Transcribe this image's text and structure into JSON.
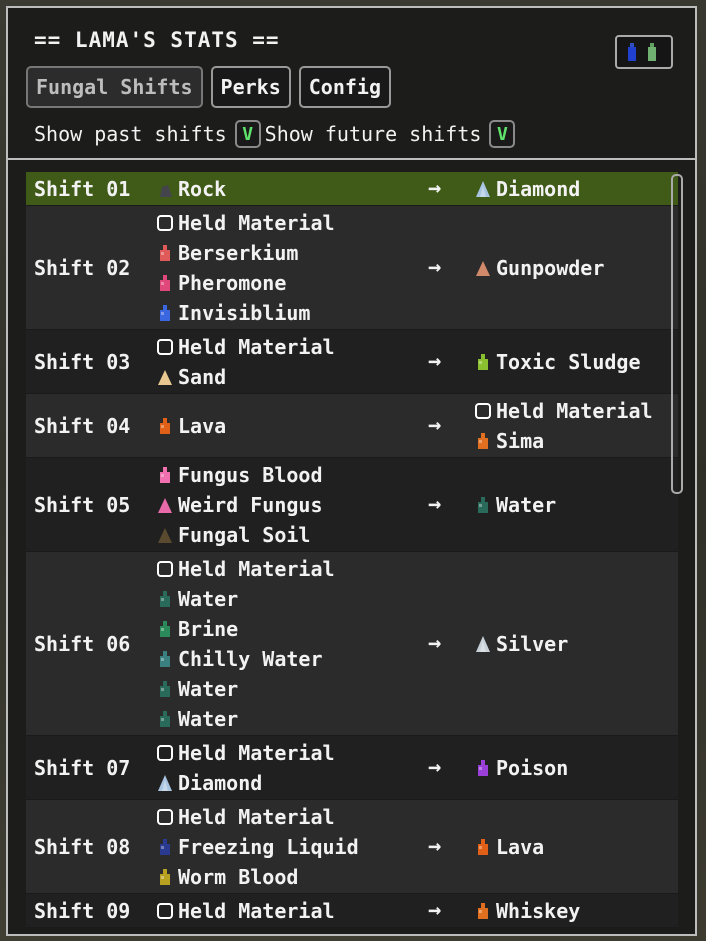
{
  "window": {
    "title": "== LAMA'S STATS ==",
    "close_icon": "potion-pair-icon",
    "tabs": [
      "Fungal Shifts",
      "Perks",
      "Config"
    ],
    "active_tab": "Fungal Shifts"
  },
  "options": {
    "show_past_label": "Show past shifts",
    "show_past_value": "V",
    "show_future_label": "Show future shifts",
    "show_future_value": "V"
  },
  "shifts": [
    {
      "label": "Shift 01",
      "highlight": true,
      "from": [
        {
          "name": "Rock",
          "icon": "rock-icon",
          "color": "#44444c"
        }
      ],
      "to": [
        {
          "name": "Diamond",
          "icon": "crystal-icon",
          "color": "#a8c4e0"
        }
      ]
    },
    {
      "label": "Shift 02",
      "from": [
        {
          "name": "Held Material",
          "icon": "held-material-icon",
          "color": "#ffffff"
        },
        {
          "name": "Berserkium",
          "icon": "flask-icon",
          "color": "#e05a5a"
        },
        {
          "name": "Pheromone",
          "icon": "flask-icon",
          "color": "#e0477a"
        },
        {
          "name": "Invisiblium",
          "icon": "flask-icon",
          "color": "#3a66e0"
        }
      ],
      "to": [
        {
          "name": "Gunpowder",
          "icon": "powder-icon",
          "color": "#d08a6a"
        }
      ]
    },
    {
      "label": "Shift 03",
      "from": [
        {
          "name": "Held Material",
          "icon": "held-material-icon",
          "color": "#ffffff"
        },
        {
          "name": "Sand",
          "icon": "powder-icon",
          "color": "#e8c890"
        }
      ],
      "to": [
        {
          "name": "Toxic Sludge",
          "icon": "flask-icon",
          "color": "#8ac030"
        }
      ]
    },
    {
      "label": "Shift 04",
      "from": [
        {
          "name": "Lava",
          "icon": "flask-icon",
          "color": "#e06018"
        }
      ],
      "to": [
        {
          "name": "Held Material",
          "icon": "held-material-icon",
          "color": "#ffffff"
        },
        {
          "name": "Sima",
          "icon": "flask-icon",
          "color": "#e07020"
        }
      ]
    },
    {
      "label": "Shift 05",
      "from": [
        {
          "name": "Fungus Blood",
          "icon": "flask-icon",
          "color": "#f070b0"
        },
        {
          "name": "Weird Fungus",
          "icon": "powder-icon",
          "color": "#e86aa8"
        },
        {
          "name": "Fungal Soil",
          "icon": "powder-icon",
          "color": "#5a4a30"
        }
      ],
      "to": [
        {
          "name": "Water",
          "icon": "flask-icon",
          "color": "#2a6a5a"
        }
      ]
    },
    {
      "label": "Shift 06",
      "from": [
        {
          "name": "Held Material",
          "icon": "held-material-icon",
          "color": "#ffffff"
        },
        {
          "name": "Water",
          "icon": "flask-icon",
          "color": "#2a6a5a"
        },
        {
          "name": "Brine",
          "icon": "flask-icon",
          "color": "#2a8a5a"
        },
        {
          "name": "Chilly Water",
          "icon": "flask-icon",
          "color": "#3a8080"
        },
        {
          "name": "Water",
          "icon": "flask-icon",
          "color": "#2a6a5a"
        },
        {
          "name": "Water",
          "icon": "flask-icon",
          "color": "#2a6a5a"
        }
      ],
      "to": [
        {
          "name": "Silver",
          "icon": "crystal-icon",
          "color": "#c8d0d8"
        }
      ]
    },
    {
      "label": "Shift 07",
      "from": [
        {
          "name": "Held Material",
          "icon": "held-material-icon",
          "color": "#ffffff"
        },
        {
          "name": "Diamond",
          "icon": "crystal-icon",
          "color": "#a8c4e0"
        }
      ],
      "to": [
        {
          "name": "Poison",
          "icon": "flask-icon",
          "color": "#9a40d8"
        }
      ]
    },
    {
      "label": "Shift 08",
      "from": [
        {
          "name": "Held Material",
          "icon": "held-material-icon",
          "color": "#ffffff"
        },
        {
          "name": "Freezing Liquid",
          "icon": "flask-icon",
          "color": "#2a3a90"
        },
        {
          "name": "Worm Blood",
          "icon": "flask-icon",
          "color": "#b8a020"
        }
      ],
      "to": [
        {
          "name": "Lava",
          "icon": "flask-icon",
          "color": "#e06018"
        }
      ]
    },
    {
      "label": "Shift 09",
      "from": [
        {
          "name": "Held Material",
          "icon": "held-material-icon",
          "color": "#ffffff"
        }
      ],
      "to": [
        {
          "name": "Whiskey",
          "icon": "flask-icon",
          "color": "#e07020"
        }
      ]
    }
  ],
  "arrow_glyph": "→"
}
